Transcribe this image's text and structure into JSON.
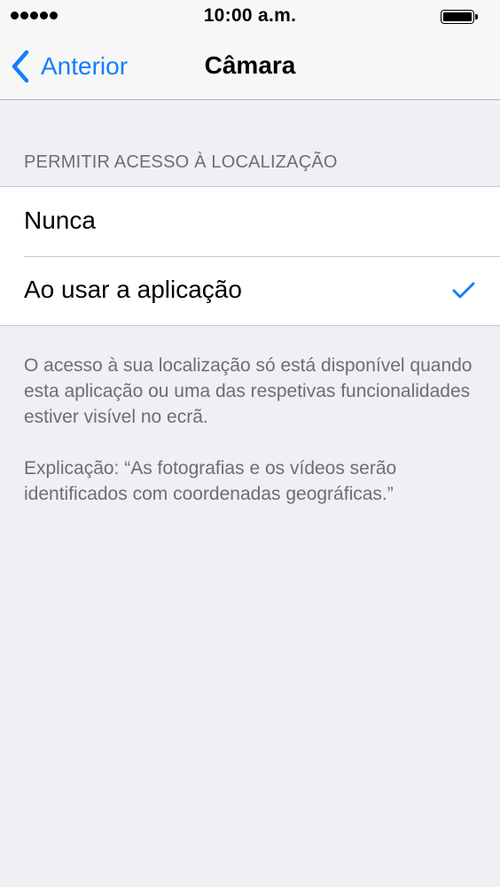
{
  "status_bar": {
    "time": "10:00 a.m.",
    "signal_bars": 5,
    "icons": [
      "signal-dots-icon",
      "battery-icon"
    ]
  },
  "nav": {
    "back_label": "Anterior",
    "back_icon": "chevron-left-icon",
    "title": "Câmara"
  },
  "section": {
    "header": "PERMITIR ACESSO À LOCALIZAÇÃO",
    "options": [
      {
        "label": "Nunca",
        "selected": false
      },
      {
        "label": "Ao usar a aplicação",
        "selected": true
      }
    ],
    "footer_paragraphs": [
      "O acesso à sua localização só está disponível quando esta aplicação ou uma das respetivas funcionalidades estiver visível no ecrã.",
      "Explicação: “As fotografias e os vídeos serão identificados com coordenadas geográficas.”"
    ]
  },
  "colors": {
    "accent": "#147efb",
    "background": "#efeff4",
    "secondary_text": "#6d6d72",
    "separator": "#c8c7cc"
  }
}
